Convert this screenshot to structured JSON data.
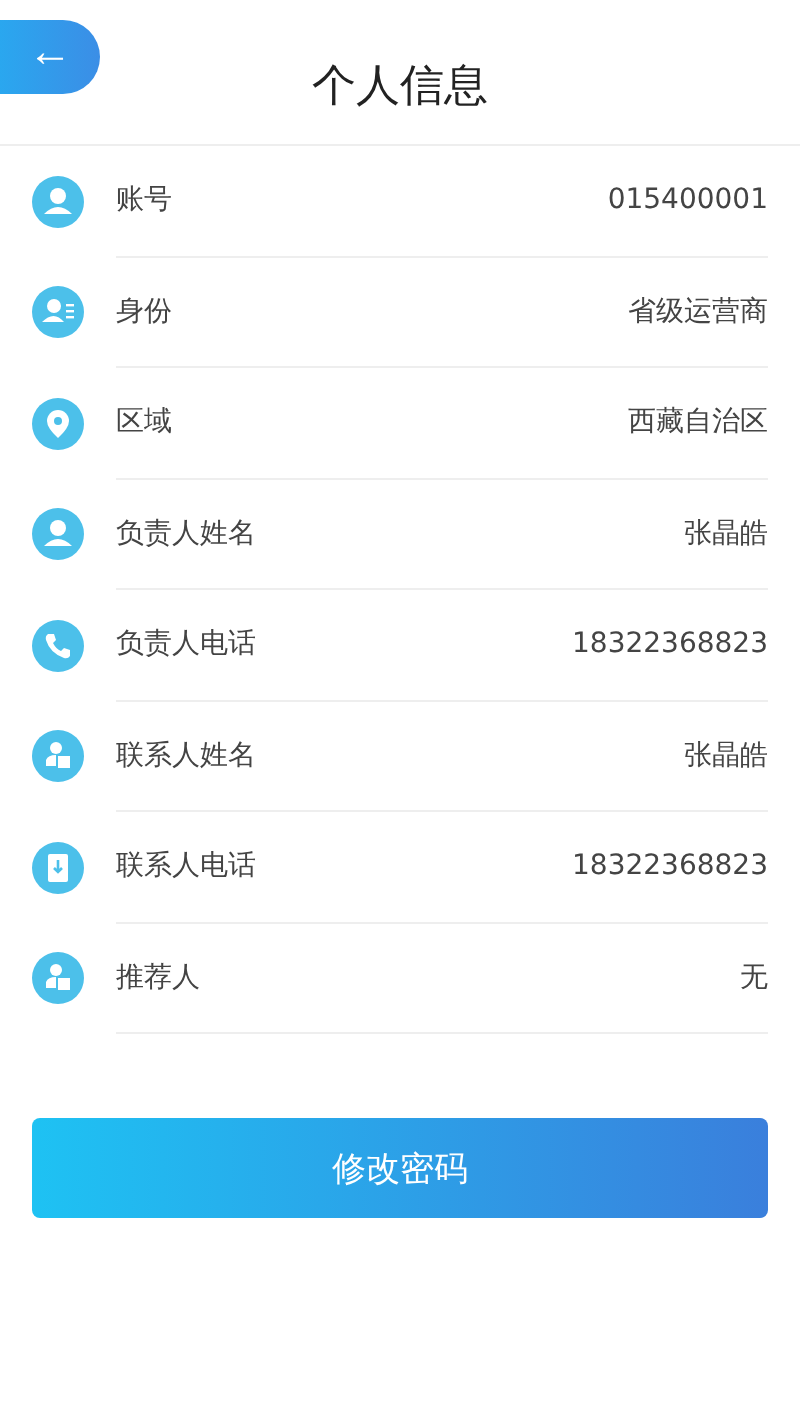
{
  "header": {
    "back_icon": "←",
    "title": "个人信息"
  },
  "rows": [
    {
      "kind": "person",
      "label": "账号",
      "value": "015400001"
    },
    {
      "kind": "idcard",
      "label": "身份",
      "value": "省级运营商"
    },
    {
      "kind": "pin",
      "label": "区域",
      "value": "西藏自治区"
    },
    {
      "kind": "person",
      "label": "负责人姓名",
      "value": "张晶皓"
    },
    {
      "kind": "phone",
      "label": "负责人电话",
      "value": "18322368823"
    },
    {
      "kind": "contact",
      "label": "联系人姓名",
      "value": "张晶皓"
    },
    {
      "kind": "book",
      "label": "联系人电话",
      "value": "18322368823"
    },
    {
      "kind": "contact",
      "label": "推荐人",
      "value": "无"
    }
  ],
  "button": "修改密码"
}
